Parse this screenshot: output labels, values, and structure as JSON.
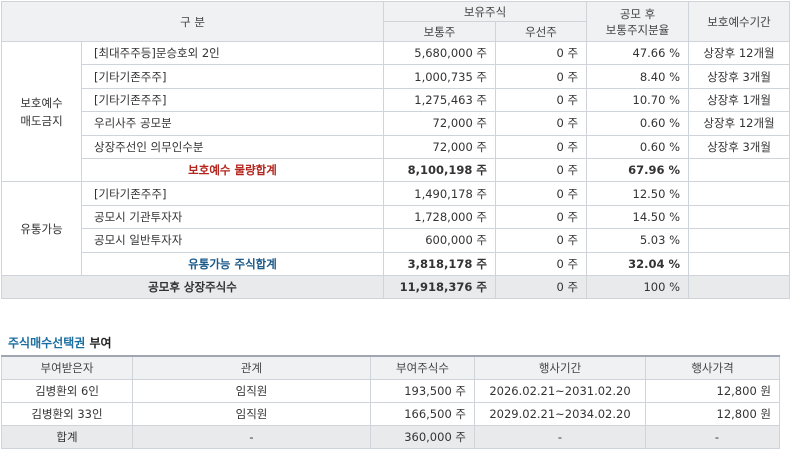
{
  "table1": {
    "headers": {
      "category": "구    분",
      "holdings": "보유주식",
      "common": "보통주",
      "preferred": "우선주",
      "ratio_line1": "공모 후",
      "ratio_line2": "보통주지분율",
      "period": "보호예수기간"
    },
    "groups": [
      {
        "label_line1": "보호예수",
        "label_line2": "매도금지",
        "rows": [
          {
            "holder": "[최대주주등]문승호외 2인",
            "common": "5,680,000 주",
            "preferred": "0 주",
            "ratio": "47.66 %",
            "period": "상장후 12개월"
          },
          {
            "holder": "[기타기존주주]",
            "common": "1,000,735 주",
            "preferred": "0 주",
            "ratio": "8.40 %",
            "period": "상장후 3개월"
          },
          {
            "holder": "[기타기존주주]",
            "common": "1,275,463 주",
            "preferred": "0 주",
            "ratio": "10.70 %",
            "period": "상장후 1개월"
          },
          {
            "holder": "우리사주 공모분",
            "common": "72,000 주",
            "preferred": "0 주",
            "ratio": "0.60 %",
            "period": "상장후 12개월"
          },
          {
            "holder": "상장주선인 의무인수분",
            "common": "72,000 주",
            "preferred": "0 주",
            "ratio": "0.60 %",
            "period": "상장후 3개월"
          }
        ],
        "subtotal": {
          "label": "보호예수 물량합계",
          "common": "8,100,198 주",
          "preferred": "0 주",
          "ratio": "67.96 %"
        }
      },
      {
        "label_line1": "유통가능",
        "rows": [
          {
            "holder": "[기타기존주주]",
            "common": "1,490,178 주",
            "preferred": "0 주",
            "ratio": "12.50 %"
          },
          {
            "holder": "공모시 기관투자자",
            "common": "1,728,000 주",
            "preferred": "0 주",
            "ratio": "14.50 %"
          },
          {
            "holder": "공모시 일반투자자",
            "common": "600,000 주",
            "preferred": "0 주",
            "ratio": "5.03 %"
          }
        ],
        "subtotal": {
          "label": "유통가능 주식합계",
          "common": "3,818,178 주",
          "preferred": "0 주",
          "ratio": "32.04 %"
        }
      }
    ],
    "total": {
      "label": "공모후 상장주식수",
      "common": "11,918,376 주",
      "preferred": "0 주",
      "ratio": "100 %"
    }
  },
  "section2": {
    "title_highlight": "주식매수선택권",
    "title_rest": " 부여",
    "headers": [
      "부여받은자",
      "관계",
      "부여주식수",
      "행사기간",
      "행사가격"
    ],
    "rows": [
      [
        "김병환외 6인",
        "임직원",
        "193,500 주",
        "2026.02.21~2031.02.20",
        "12,800 원"
      ],
      [
        "김병환외 33인",
        "임직원",
        "166,500 주",
        "2029.02.21~2034.02.20",
        "12,800 원"
      ],
      [
        "합계",
        "-",
        "360,000 주",
        "-",
        "-"
      ]
    ]
  },
  "colors": {
    "subtotal_red": "#b3261e",
    "subtotal_blue": "#1b5a8a",
    "header_bg": "#f0f1f3",
    "title_highlight": "#1b6ea0"
  }
}
